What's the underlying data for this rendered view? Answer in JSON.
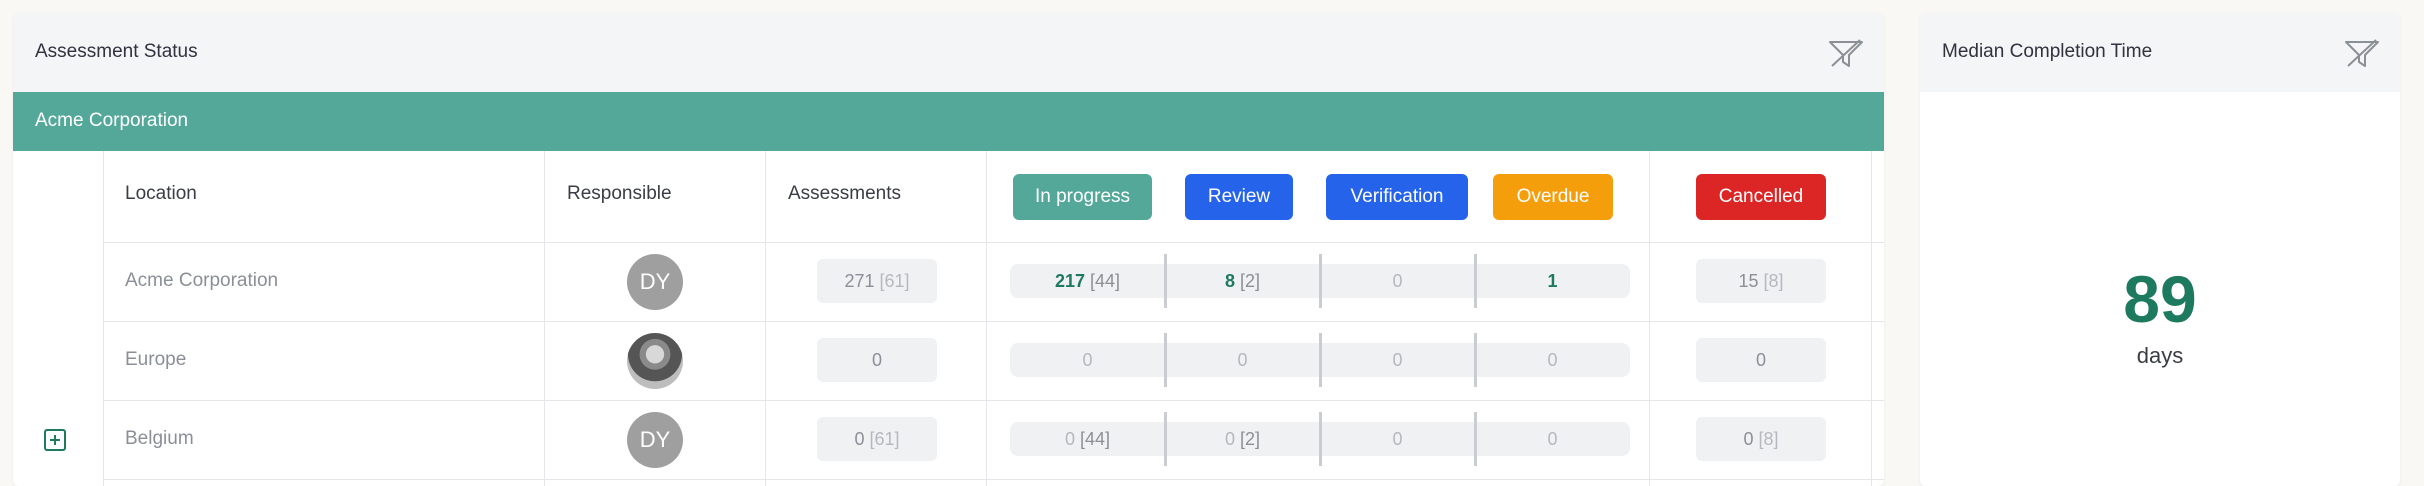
{
  "status_panel": {
    "title": "Assessment Status",
    "filter_icon": "filter-icon",
    "company": "Acme Corporation",
    "headers": {
      "location": "Location",
      "responsible": "Responsible",
      "assessments": "Assessments"
    },
    "status_buttons": [
      {
        "label": "In progress",
        "color": "#54a899"
      },
      {
        "label": "Review",
        "color": "#2563eb"
      },
      {
        "label": "Verification",
        "color": "#2563eb"
      },
      {
        "label": "Overdue",
        "color": "#f59e0b"
      },
      {
        "label": "Cancelled",
        "color": "#dc2626"
      }
    ],
    "rows": [
      {
        "location": "Acme Corporation",
        "responsible": "DY",
        "assessments": {
          "value": "271",
          "sub": "[61]"
        },
        "in_progress": {
          "value": "217",
          "sub": "[44]"
        },
        "review": {
          "value": "8",
          "sub": "[2]"
        },
        "verification": {
          "value": "0"
        },
        "overdue": {
          "value": "1"
        },
        "cancelled": {
          "value": "15",
          "sub": "[8]"
        }
      },
      {
        "location": "Europe",
        "responsible": "",
        "assessments": {
          "value": "0"
        },
        "in_progress": {
          "value": "0"
        },
        "review": {
          "value": "0"
        },
        "verification": {
          "value": "0"
        },
        "overdue": {
          "value": "0"
        },
        "cancelled": {
          "value": "0"
        }
      },
      {
        "location": "Belgium",
        "responsible": "DY",
        "assessments": {
          "value": "0",
          "sub": "[61]"
        },
        "in_progress": {
          "value": "0",
          "sub": "[44]"
        },
        "review": {
          "value": "0",
          "sub": "[2]"
        },
        "verification": {
          "value": "0"
        },
        "overdue": {
          "value": "0"
        },
        "cancelled": {
          "value": "0",
          "sub": "[8]"
        }
      }
    ]
  },
  "median_panel": {
    "title": "Median Completion Time",
    "value": "89",
    "unit": "days"
  }
}
